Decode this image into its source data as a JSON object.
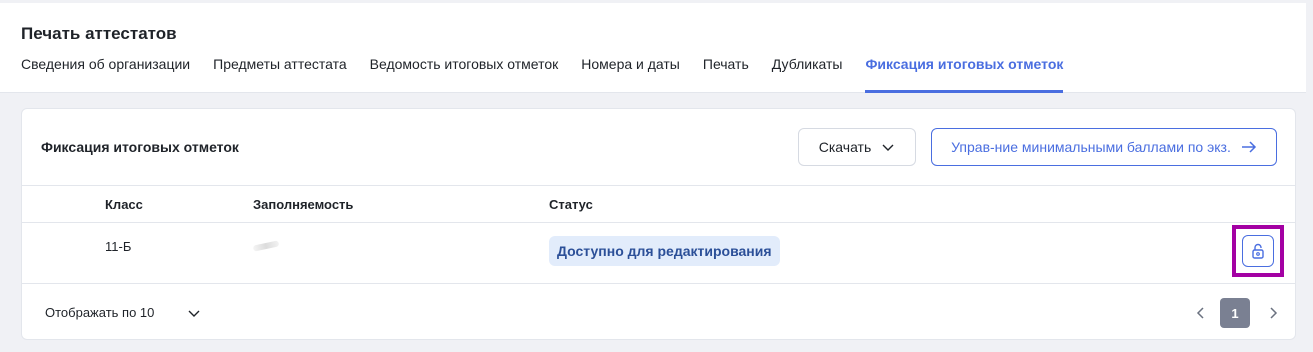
{
  "page": {
    "title": "Печать аттестатов",
    "tabs": [
      {
        "label": "Сведения об организации",
        "active": false
      },
      {
        "label": "Предметы аттестата",
        "active": false
      },
      {
        "label": "Ведомость итоговых отметок",
        "active": false
      },
      {
        "label": "Номера и даты",
        "active": false
      },
      {
        "label": "Печать",
        "active": false
      },
      {
        "label": "Дубликаты",
        "active": false
      },
      {
        "label": "Фиксация итоговых отметок",
        "active": true
      }
    ]
  },
  "card": {
    "title": "Фиксация итоговых отметок",
    "download_label": "Скачать",
    "manage_label": "Управ-ние минимальными баллами по экз."
  },
  "table": {
    "columns": [
      "Класс",
      "Заполняемость",
      "Статус"
    ],
    "rows": [
      {
        "class": "11-Б",
        "fill": "",
        "status": "Доступно для редактирования"
      }
    ]
  },
  "footer": {
    "page_size_label": "Отображать по 10",
    "current_page": "1"
  },
  "colors": {
    "accent": "#4a6ee0",
    "status_bg": "#e2ecfb",
    "status_text": "#2b4f98",
    "highlight": "#a300a3"
  },
  "icons": {
    "download_chevron": "chevron-down-icon",
    "manage_arrow": "arrow-right-icon",
    "row_action": "lock-open-icon",
    "page_size": "chevron-down-icon",
    "prev": "chevron-left-icon",
    "next": "chevron-right-icon"
  }
}
